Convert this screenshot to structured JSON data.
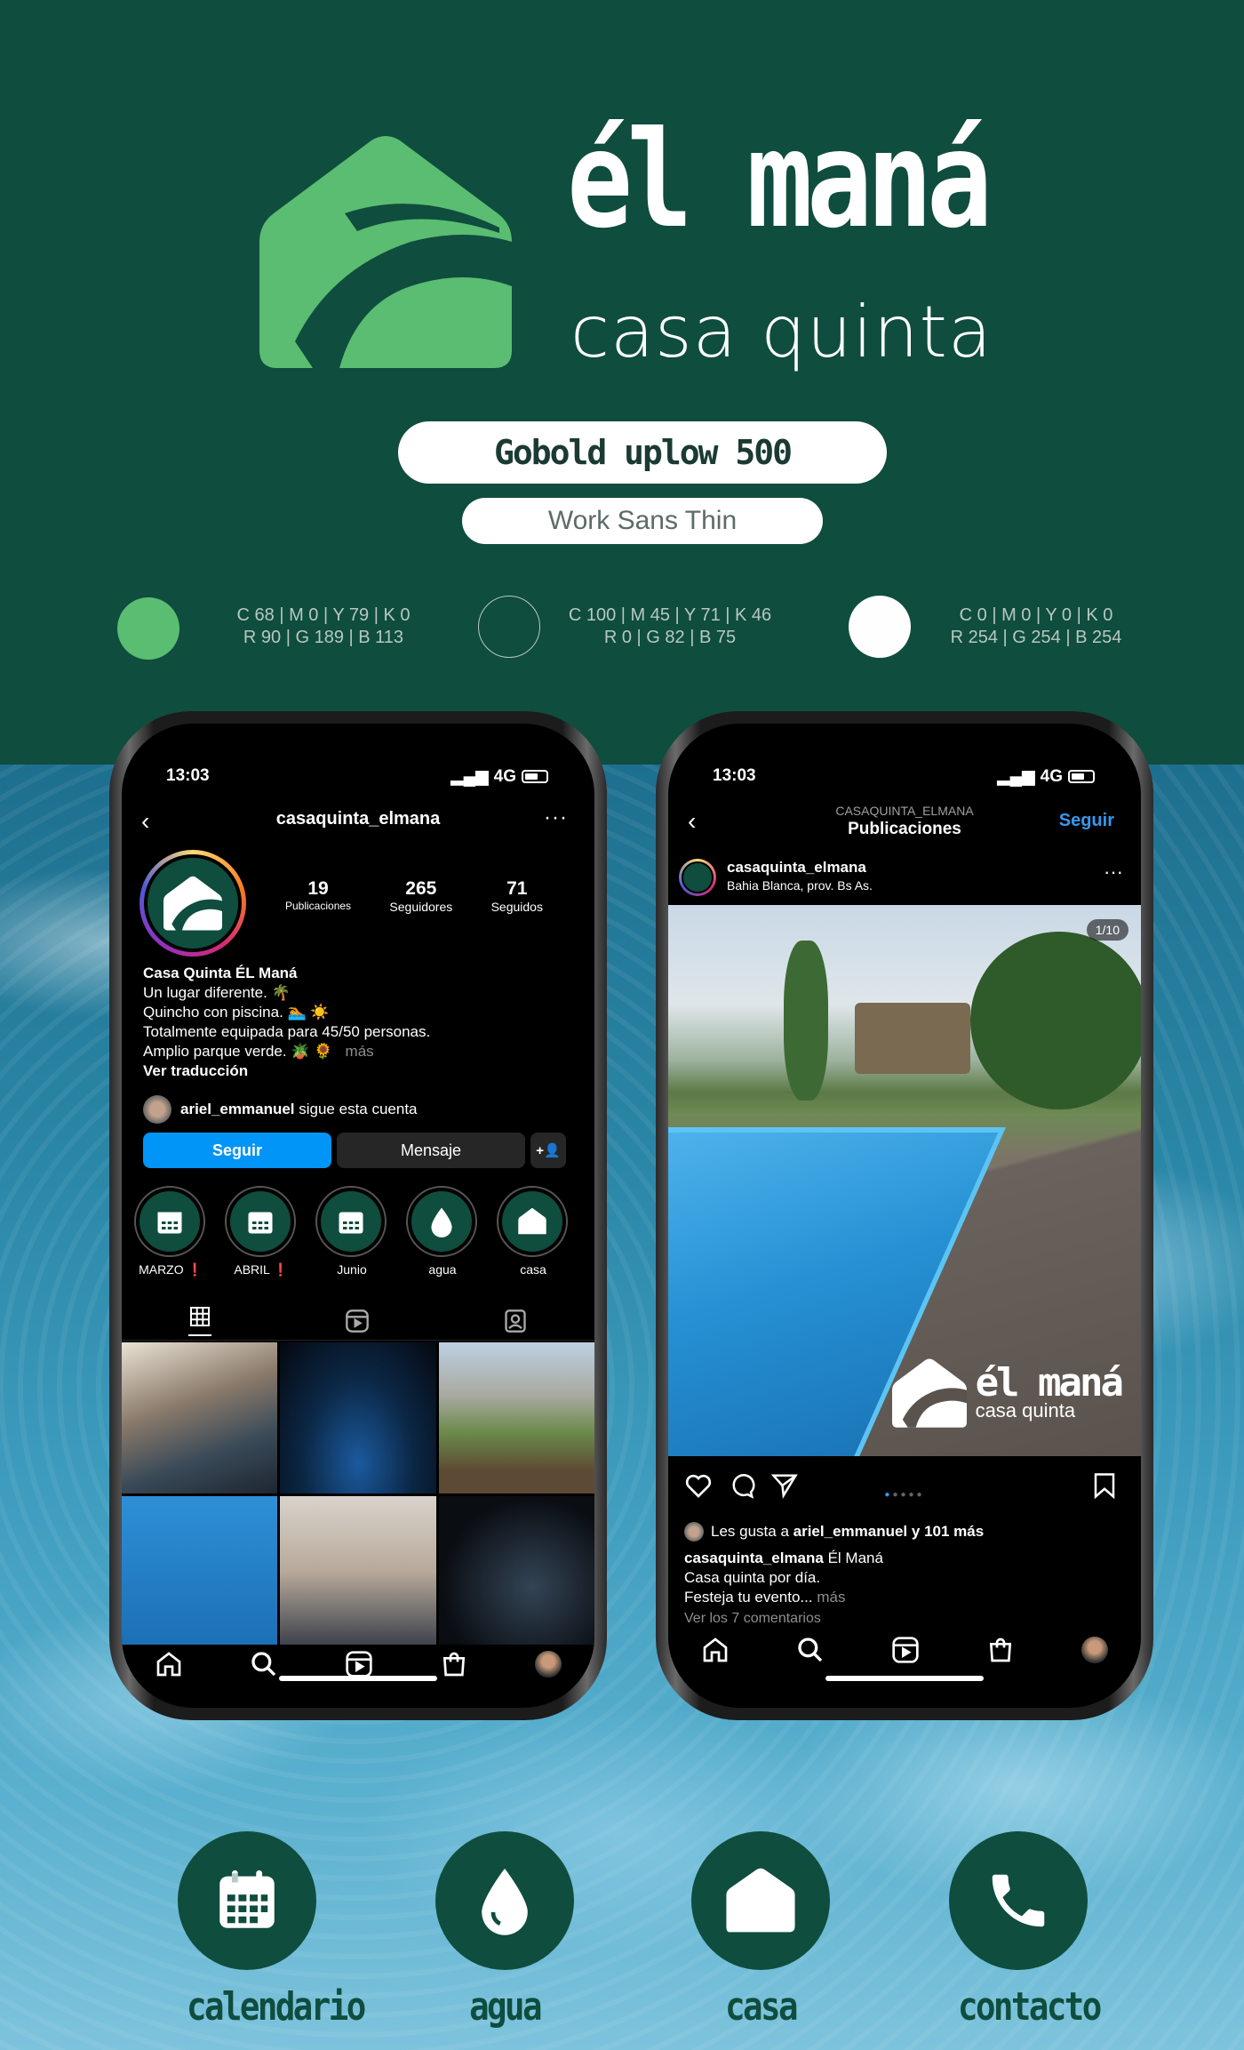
{
  "brand": {
    "name": "él maná",
    "tagline": "casa quinta",
    "font_primary": "Gobold uplow 500",
    "font_secondary": "Work Sans Thin"
  },
  "colors": {
    "green": {
      "hex": "#5abd71",
      "cmyk": "C 68 | M 0 | Y 79 | K 0",
      "rgb": "R 90 | G 189 | B 113"
    },
    "dark": {
      "hex": "#00524b",
      "cmyk": "C 100 | M 45 | Y 71 | K 46",
      "rgb": "R 0 | G 82 | B 75"
    },
    "white": {
      "hex": "#fefefe",
      "cmyk": "C 0 | M 0 | Y 0 | K 0",
      "rgb": "R 254 | G 254 | B 254"
    }
  },
  "phone_profile": {
    "time": "13:03",
    "network": "4G",
    "username": "casaquinta_elmana",
    "stats": [
      {
        "value": "19",
        "label": "Publicaciones"
      },
      {
        "value": "265",
        "label": "Seguidores"
      },
      {
        "value": "71",
        "label": "Seguidos"
      }
    ],
    "bio_name": "Casa Quinta ÉL Maná",
    "bio_line1": "Un lugar diferente. 🌴",
    "bio_line2": "Quincho con piscina. 🏊 ☀️",
    "bio_line3": "Totalmente equipada para 45/50 personas.",
    "bio_line4": "Amplio parque verde. 🪴 🌻",
    "bio_more": "más",
    "translate": "Ver traducción",
    "followed_by_user": "ariel_emmanuel",
    "followed_by_text": "sigue esta cuenta",
    "follow_button": "Seguir",
    "message_button": "Mensaje",
    "highlights": [
      {
        "label": "MARZO ❗",
        "icon": "calendar-icon"
      },
      {
        "label": "ABRIL ❗",
        "icon": "calendar-icon"
      },
      {
        "label": "Junio",
        "icon": "calendar-icon"
      },
      {
        "label": "agua",
        "icon": "drop-icon"
      },
      {
        "label": "casa",
        "icon": "house-icon"
      }
    ]
  },
  "phone_post": {
    "time": "13:03",
    "network": "4G",
    "header_small": "CASAQUINTA_ELMANA",
    "header_title": "Publicaciones",
    "follow_link": "Seguir",
    "post_user": "casaquinta_elmana",
    "post_location": "Bahia Blanca, prov. Bs As.",
    "image_counter": "1/10",
    "watermark_title": "él maná",
    "watermark_sub": "casa quinta",
    "likes_prefix": "Les gusta a",
    "likes_user": "ariel_emmanuel",
    "likes_suffix": "y 101 más",
    "caption_user": "casaquinta_elmana",
    "caption_text": "Él Maná",
    "caption_line2": "Casa quinta por día.",
    "caption_line3": "Festeja tu evento...",
    "caption_more": "más",
    "comments": "Ver los 7 comentarios"
  },
  "bottom_icons": [
    {
      "label": "calendario",
      "icon": "calendar-icon"
    },
    {
      "label": "agua",
      "icon": "drop-icon"
    },
    {
      "label": "casa",
      "icon": "house-icon"
    },
    {
      "label": "contacto",
      "icon": "phone-icon"
    }
  ]
}
